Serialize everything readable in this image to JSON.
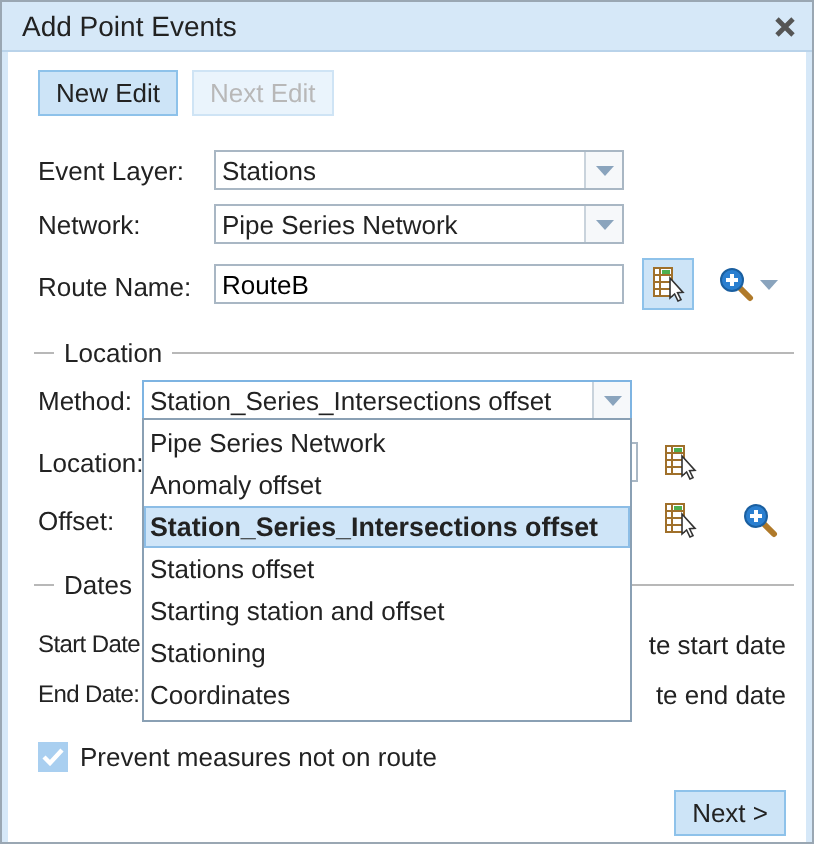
{
  "window": {
    "title": "Add Point Events"
  },
  "toolbar": [
    {
      "label": "New Edit",
      "disabled": false
    },
    {
      "label": "Next Edit",
      "disabled": true
    }
  ],
  "fields": [
    {
      "kind": "select",
      "label": "Event Layer:",
      "value": "Stations"
    },
    {
      "kind": "select",
      "label": "Network:",
      "value": "Pipe Series Network"
    },
    {
      "kind": "text",
      "label": "Route Name:",
      "value": "RouteB"
    }
  ],
  "location": {
    "title": "Location",
    "method": {
      "label": "Method:",
      "value": "Station_Series_Intersections offset",
      "expanded": true,
      "options": [
        {
          "label": "Pipe Series Network",
          "selected": false
        },
        {
          "label": "Anomaly offset",
          "selected": false
        },
        {
          "label": "Station_Series_Intersections offset",
          "selected": true
        },
        {
          "label": "Stations offset",
          "selected": false
        },
        {
          "label": "Starting station and offset",
          "selected": false
        },
        {
          "label": "Stationing",
          "selected": false
        },
        {
          "label": "Coordinates",
          "selected": false
        }
      ]
    },
    "rows": [
      {
        "label": "Location:",
        "zoom": false
      },
      {
        "label": "Offset:",
        "zoom": true
      }
    ]
  },
  "dates": {
    "title": "Dates",
    "rows": [
      {
        "label": "Start Date",
        "note": "te start date"
      },
      {
        "label": "End Date:",
        "note": "te end date"
      }
    ]
  },
  "prevent": {
    "label": "Prevent measures not on route",
    "checked": true
  },
  "next_button": "Next >"
}
